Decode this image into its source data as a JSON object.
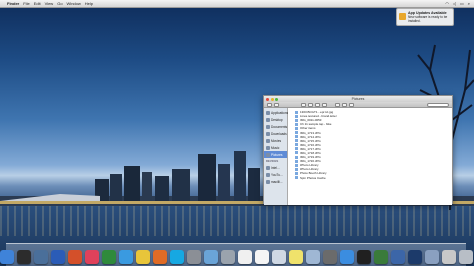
{
  "menubar": {
    "apple_glyph": "",
    "app_name": "Finder",
    "items": [
      "File",
      "Edit",
      "View",
      "Go",
      "Window",
      "Help"
    ],
    "right_items": [
      "",
      "",
      "",
      ""
    ]
  },
  "notification": {
    "title": "App Updates Available",
    "body": "New software is ready to be installed.",
    "icon": "app-store-icon"
  },
  "finder": {
    "title": "Pictures",
    "sidebar": {
      "favorites": [
        "Applications",
        "Desktop",
        "Documents",
        "Downloads",
        "Movies",
        "Music",
        "Pictures"
      ],
      "selected": "Pictures",
      "devices_header": "DEVICES",
      "devices": [
        "Intel...",
        ""
      ],
      "shared": [
        "YouTu...",
        "macilli..."
      ]
    },
    "files": [
      "1303.BCGT1 - epr.txt.jpg",
      "Lines.textured - brand.letter",
      "IMG_0011-0053",
      "Ch 11 sample tap - bike",
      "Other items",
      "IMG_1713.JPG",
      "IMG_1714.JPG",
      "IMG_1715.JPG",
      "IMG_1716.JPG",
      "IMG_1717.JPG",
      "IMG_1718.JPG",
      "IMG_1719.JPG",
      "IMG_1720.JPG",
      "iPhoto Library",
      "iPhoto Library",
      "Photo Booth Library",
      "Spin Photos Cache"
    ]
  },
  "dock": {
    "icons": [
      {
        "name": "finder-icon",
        "color": "#3f83d9"
      },
      {
        "name": "dashboard-icon",
        "color": "#2c2c2c"
      },
      {
        "name": "mission-control-icon",
        "color": "#4a6f9a"
      },
      {
        "name": "word-icon",
        "color": "#2b5cb7"
      },
      {
        "name": "powerpoint-icon",
        "color": "#d4502a"
      },
      {
        "name": "itunes-icon",
        "color": "#e0415b"
      },
      {
        "name": "excel-icon",
        "color": "#2f8a3c"
      },
      {
        "name": "safari-icon",
        "color": "#3a9ae0"
      },
      {
        "name": "chrome-icon",
        "color": "#e8c53a"
      },
      {
        "name": "firefox-icon",
        "color": "#e06b25"
      },
      {
        "name": "skype-icon",
        "color": "#16a8e2"
      },
      {
        "name": "system-preferences-icon",
        "color": "#8b8f96"
      },
      {
        "name": "iphoto-icon",
        "color": "#6aa4d8"
      },
      {
        "name": "launchpad-icon",
        "color": "#9aa3ad"
      },
      {
        "name": "textedit-icon",
        "color": "#f0f0f0"
      },
      {
        "name": "calendar-icon",
        "color": "#f5f5f5"
      },
      {
        "name": "mail-icon",
        "color": "#cfd8e4"
      },
      {
        "name": "stickies-icon",
        "color": "#efe26b"
      },
      {
        "name": "preview-icon",
        "color": "#9fb7d4"
      },
      {
        "name": "imovie-icon",
        "color": "#6b6b6b"
      },
      {
        "name": "app-store-icon",
        "color": "#3b8de0"
      },
      {
        "name": "terminal-icon",
        "color": "#202020"
      },
      {
        "name": "facetime-icon",
        "color": "#3a7b3a"
      },
      {
        "name": "quicktime-icon",
        "color": "#3c66a8"
      },
      {
        "name": "photoshop-icon",
        "color": "#1c3a6a"
      },
      {
        "name": "downloads-stack-icon",
        "color": "#8aa0c0"
      },
      {
        "name": "documents-stack-icon",
        "color": "#c8c8c8"
      },
      {
        "name": "trash-icon",
        "color": "#b8bec6"
      }
    ]
  }
}
